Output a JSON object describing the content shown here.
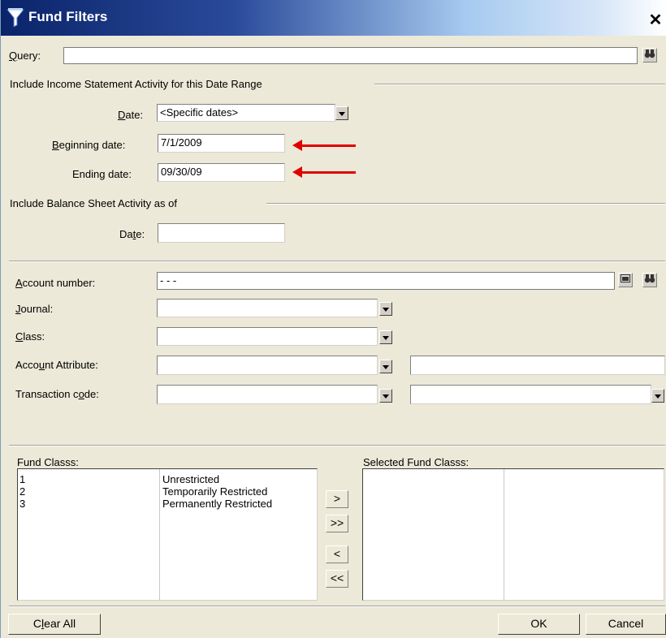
{
  "window": {
    "title": "Fund Filters",
    "close_glyph": "✕"
  },
  "query": {
    "label": "Query:",
    "value": ""
  },
  "income_group": {
    "label": "Include Income Statement Activity for this Date Range"
  },
  "date_range": {
    "date_label": "Date:",
    "date_value": "<Specific dates>",
    "beginning_label": "Beginning date:",
    "beginning_value": "7/1/2009",
    "ending_label": "Ending date:",
    "ending_value": "09/30/09"
  },
  "balance_group": {
    "label": "Include Balance Sheet Activity as of",
    "date_label": "Date:",
    "date_value": ""
  },
  "account": {
    "label": "Account number:",
    "value": "-  - -"
  },
  "journal": {
    "label": "Journal:",
    "value": ""
  },
  "class": {
    "label": "Class:",
    "value": ""
  },
  "attribute": {
    "label": "Account Attribute:",
    "value": "",
    "value2": ""
  },
  "transaction": {
    "label": "Transaction code:",
    "value": "",
    "value2": ""
  },
  "fund_classes": {
    "label": "Fund Classs:",
    "items": [
      {
        "code": "1",
        "name": "Unrestricted"
      },
      {
        "code": "2",
        "name": "Temporarily Restricted"
      },
      {
        "code": "3",
        "name": "Permanently Restricted"
      }
    ]
  },
  "selected_fund_classes": {
    "label": "Selected Fund Classs:"
  },
  "move_buttons": {
    "add": ">",
    "add_all": ">>",
    "remove": "<",
    "remove_all": "<<"
  },
  "buttons": {
    "clear_all": "Clear All",
    "ok": "OK",
    "cancel": "Cancel"
  },
  "colors": {
    "annotation_arrow": "#e00000",
    "titlebar_start": "#0a246a",
    "dialog_bg": "#ece9d8"
  },
  "icons": {
    "title": "filter-funnel-icon",
    "binoculars": "binoculars-icon",
    "lookup": "lookup-icon"
  }
}
